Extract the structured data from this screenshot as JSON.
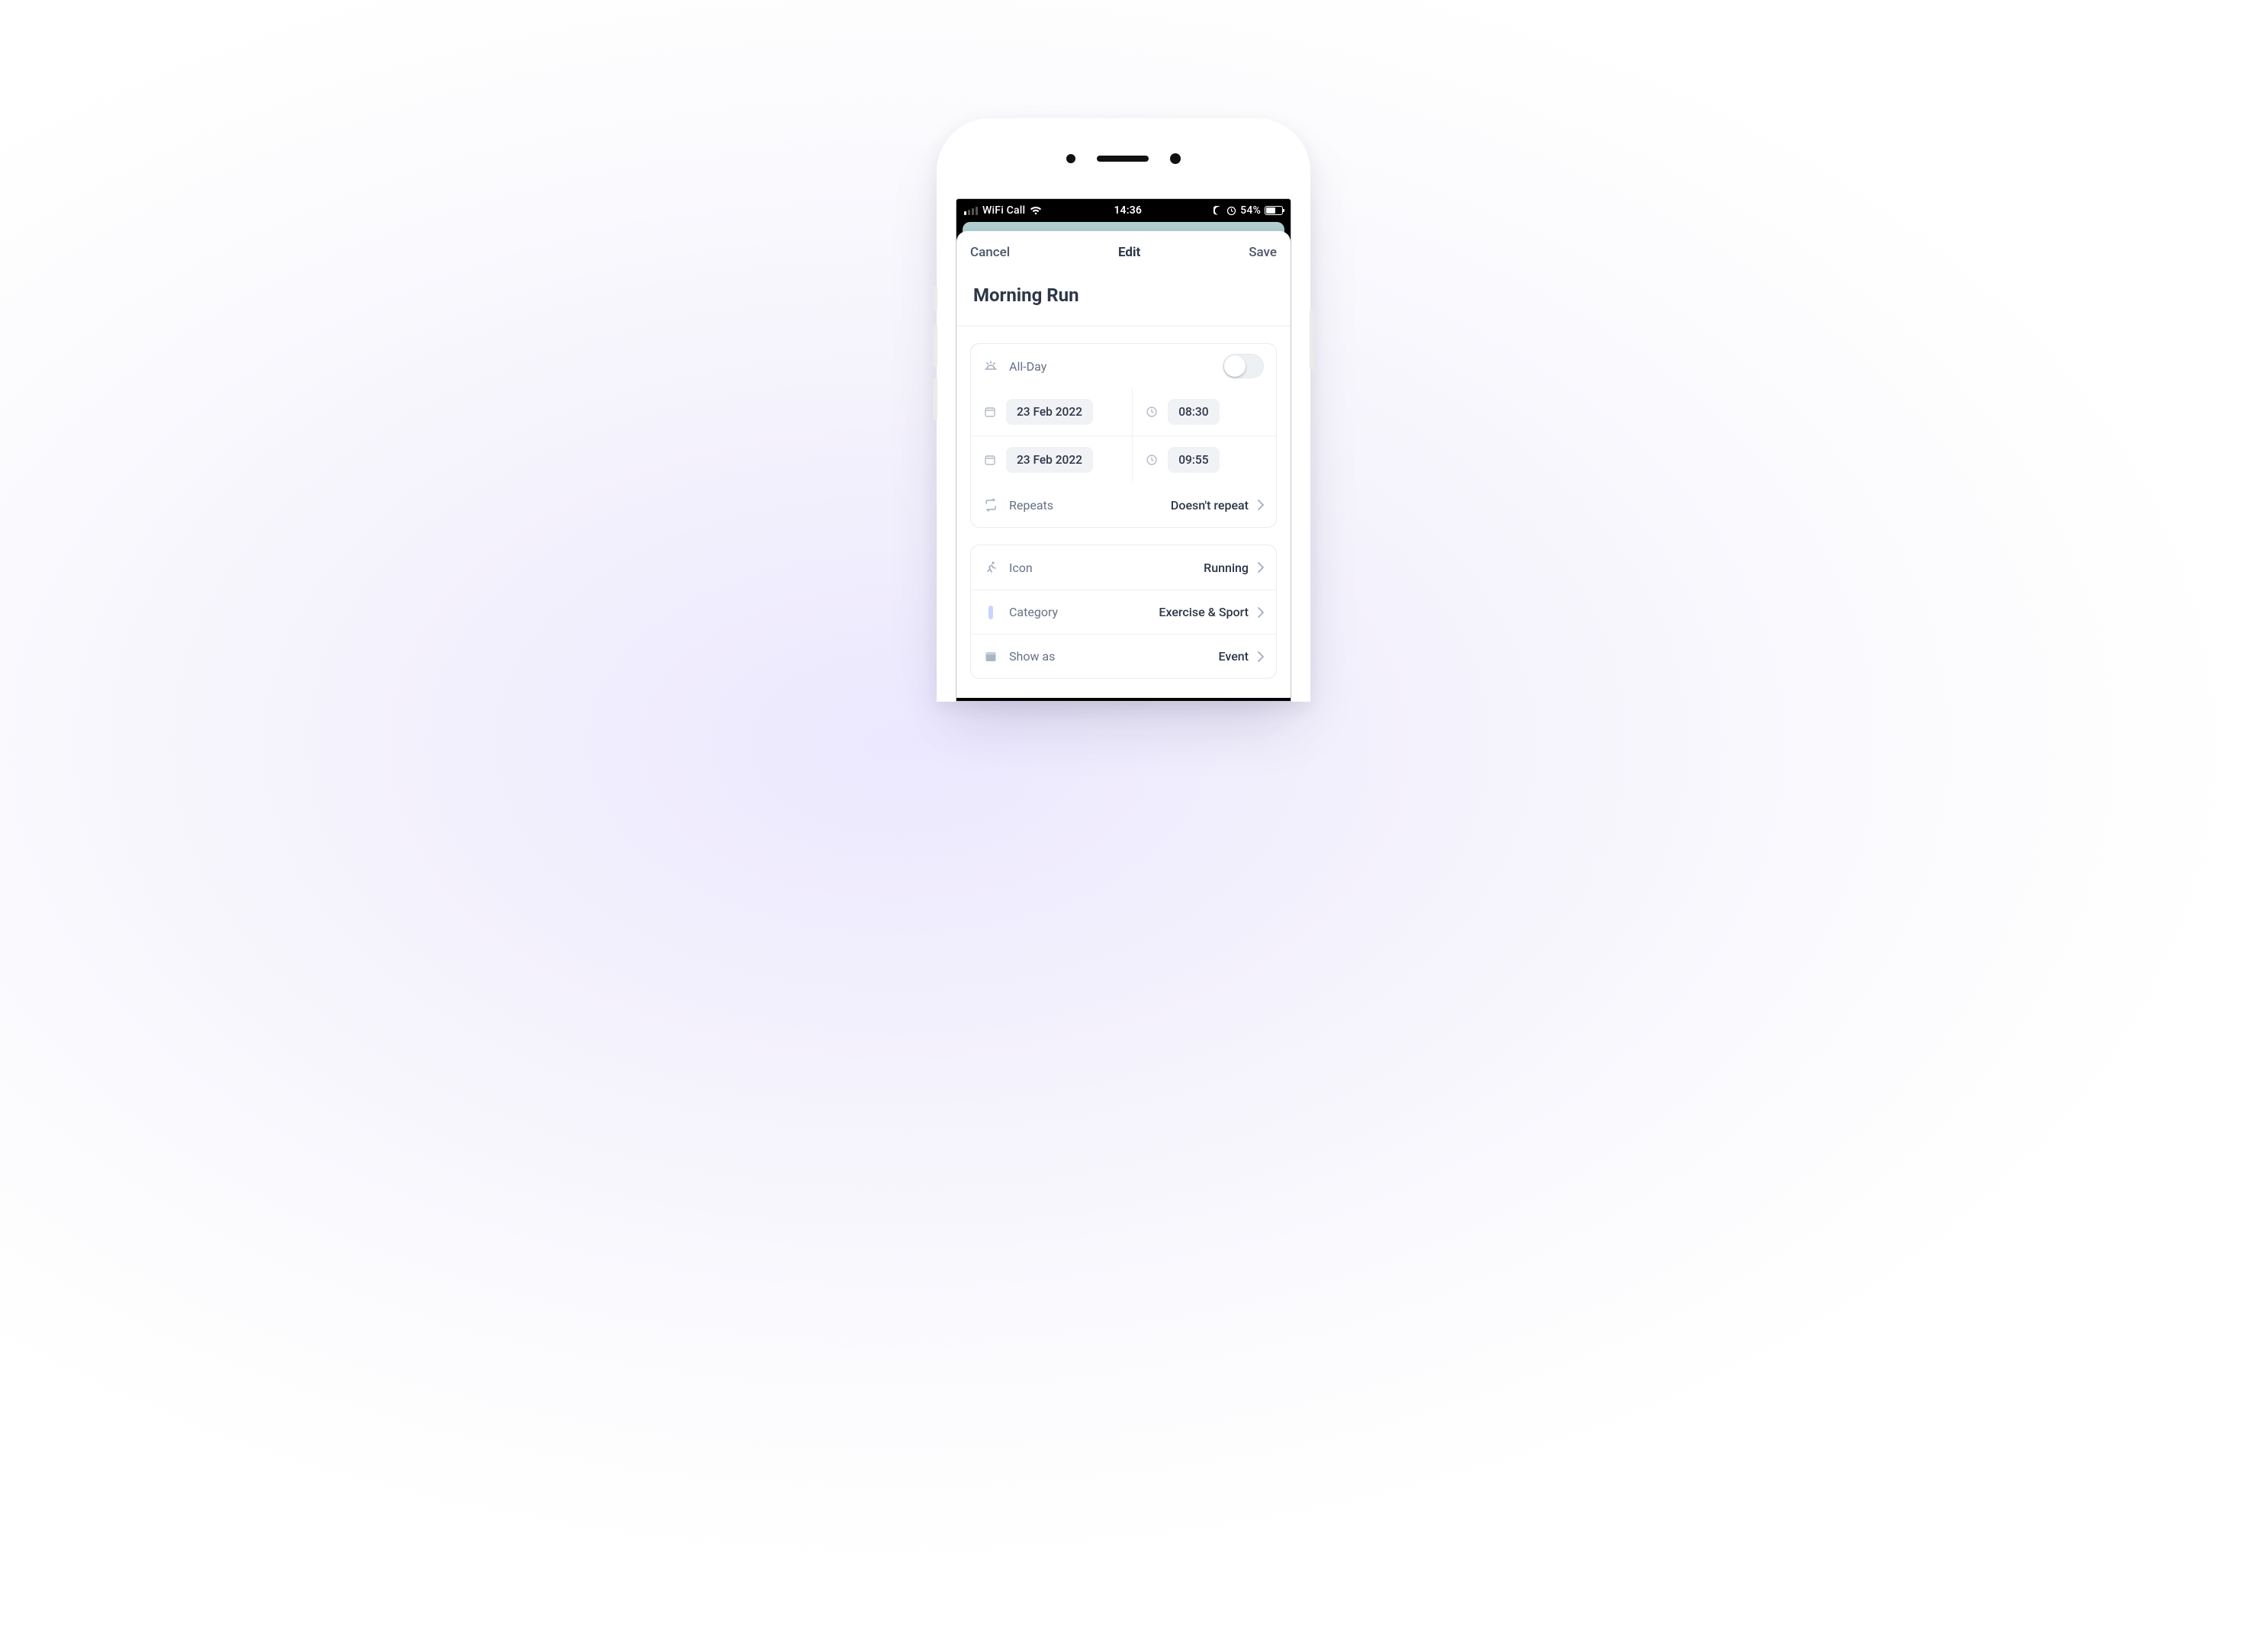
{
  "statusbar": {
    "carrier": "WiFi Call",
    "time": "14:36",
    "battery_pct": "54%"
  },
  "nav": {
    "cancel": "Cancel",
    "title": "Edit",
    "save": "Save"
  },
  "event": {
    "title": "Morning Run",
    "allday_label": "All-Day",
    "allday_on": false,
    "start_date": "23 Feb 2022",
    "start_time": "08:30",
    "end_date": "23 Feb 2022",
    "end_time": "09:55",
    "repeats_label": "Repeats",
    "repeats_value": "Doesn't repeat",
    "icon_label": "Icon",
    "icon_value": "Running",
    "category_label": "Category",
    "category_value": "Exercise & Sport",
    "showas_label": "Show as",
    "showas_value": "Event"
  }
}
